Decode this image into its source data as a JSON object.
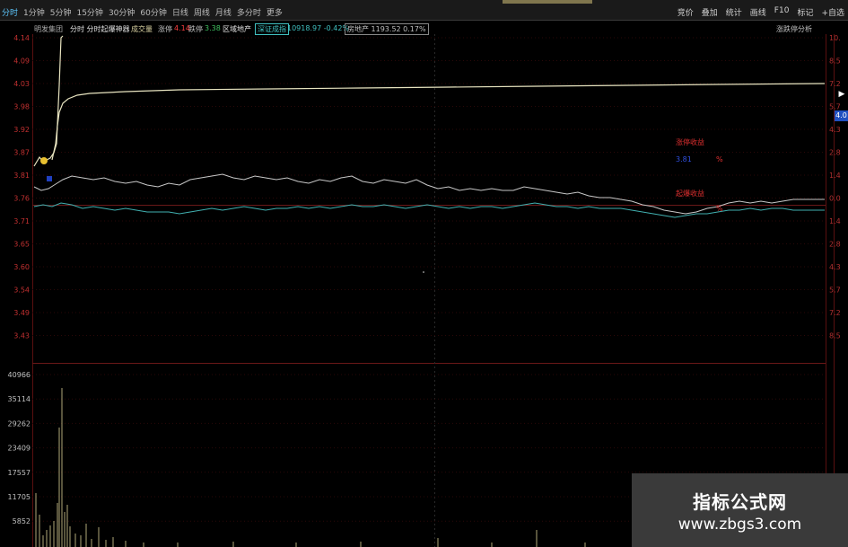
{
  "header": {
    "tabs": [
      {
        "label": "分时",
        "active": true
      },
      {
        "label": "1分钟",
        "active": false
      },
      {
        "label": "5分钟",
        "active": false
      },
      {
        "label": "15分钟",
        "active": false
      },
      {
        "label": "30分钟",
        "active": false
      },
      {
        "label": "60分钟",
        "active": false
      },
      {
        "label": "日线",
        "active": false
      },
      {
        "label": "周线",
        "active": false
      },
      {
        "label": "月线",
        "active": false
      },
      {
        "label": "多分时",
        "active": false
      },
      {
        "label": "更多",
        "active": false
      }
    ],
    "tools": [
      "竞价",
      "叠加",
      "统计",
      "画线",
      "F10",
      "标记",
      "+自选"
    ]
  },
  "info": {
    "stock_name": "明发集团",
    "indicator_name": "分时 分时起爆神器",
    "volume_label": "成交量",
    "up_limit_label": "涨停",
    "up_limit_value": "4.14",
    "down_limit_label": "跌停",
    "down_limit_value": "3.38",
    "sector_label": "区域地产",
    "index_box": "深证成指",
    "index_value": "10918.97 -0.42%",
    "sector2_box": "房地产 1193.52 0.17%",
    "analysis_link": "涨跌停分析"
  },
  "price_axis": [
    "4.14",
    "4.09",
    "4.03",
    "3.98",
    "3.92",
    "3.87",
    "3.81",
    "3.76",
    "3.71",
    "3.65",
    "3.60",
    "3.54",
    "3.49",
    "3.43"
  ],
  "pct_axis": [
    "10.",
    "8.5",
    "7.2",
    "5.7",
    "4.3",
    "2.8",
    "1.4",
    "0.0",
    "1.4",
    "2.8",
    "4.3",
    "5.7",
    "7.2",
    "8.5"
  ],
  "volume_axis": [
    "40966",
    "35114",
    "29262",
    "23409",
    "17557",
    "11705",
    "5852"
  ],
  "side_panel": {
    "arrow": "▶",
    "badge": "4.0"
  },
  "annotations": {
    "label1": "涨停收益",
    "label2": "起爆收益",
    "pct_mark": "%",
    "blue_mark": "3.81"
  },
  "colors": {
    "price_line": "#e8e4c0",
    "avg_line": "#40b0b0",
    "white_line": "#d0d0d0",
    "grid": "#5a1010",
    "volume": "#b0a878"
  },
  "watermark": {
    "title": "指标公式网",
    "url": "www.zbgs3.com"
  }
}
